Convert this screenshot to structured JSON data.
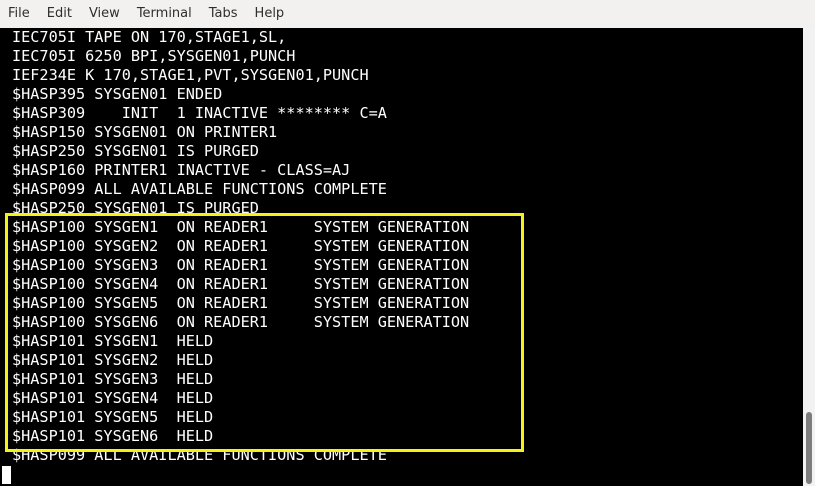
{
  "menu": {
    "items": [
      "File",
      "Edit",
      "View",
      "Terminal",
      "Tabs",
      "Help"
    ]
  },
  "terminal": {
    "lines": [
      "IEC705I TAPE ON 170,STAGE1,SL,",
      "IEC705I 6250 BPI,SYSGEN01,PUNCH",
      "IEF234E K 170,STAGE1,PVT,SYSGEN01,PUNCH",
      "$HASP395 SYSGEN01 ENDED",
      "$HASP309    INIT  1 INACTIVE ******** C=A",
      "$HASP150 SYSGEN01 ON PRINTER1",
      "$HASP250 SYSGEN01 IS PURGED",
      "$HASP160 PRINTER1 INACTIVE - CLASS=AJ",
      "$HASP099 ALL AVAILABLE FUNCTIONS COMPLETE",
      "$HASP250 SYSGEN01 IS PURGED",
      "$HASP100 SYSGEN1  ON READER1     SYSTEM GENERATION",
      "$HASP100 SYSGEN2  ON READER1     SYSTEM GENERATION",
      "$HASP100 SYSGEN3  ON READER1     SYSTEM GENERATION",
      "$HASP100 SYSGEN4  ON READER1     SYSTEM GENERATION",
      "$HASP100 SYSGEN5  ON READER1     SYSTEM GENERATION",
      "$HASP100 SYSGEN6  ON READER1     SYSTEM GENERATION",
      "$HASP101 SYSGEN1  HELD",
      "$HASP101 SYSGEN2  HELD",
      "$HASP101 SYSGEN3  HELD",
      "$HASP101 SYSGEN4  HELD",
      "$HASP101 SYSGEN5  HELD",
      "$HASP101 SYSGEN6  HELD",
      "$HASP099 ALL AVAILABLE FUNCTIONS COMPLETE"
    ]
  },
  "colors": {
    "background": "#000000",
    "text": "#ffffff",
    "highlight": "#f3f31a",
    "menubar": "#f2f1f0"
  }
}
